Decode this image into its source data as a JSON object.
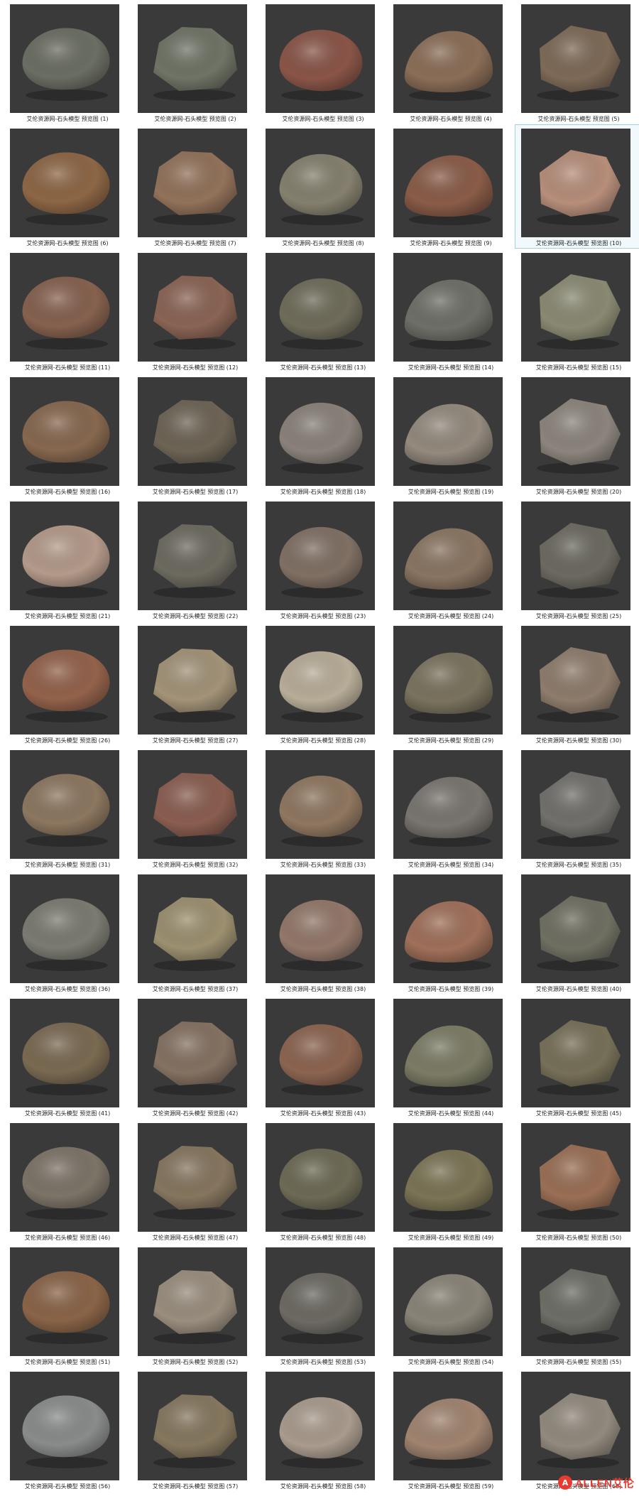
{
  "caption_prefix": "艾伦资源网-石头模型 预览图",
  "selected_index": 10,
  "watermark": {
    "icon": "logo-circle-icon",
    "text": "ALLEN艾伦"
  },
  "items": [
    {
      "label": "艾伦资源网-石头模型 预览图 (1)",
      "color": "#6b6e63"
    },
    {
      "label": "艾伦资源网-石头模型 预览图 (2)",
      "color": "#6f7466"
    },
    {
      "label": "艾伦资源网-石头模型 预览图 (3)",
      "color": "#8a5548"
    },
    {
      "label": "艾伦资源网-石头模型 预览图 (4)",
      "color": "#8b6e57"
    },
    {
      "label": "艾伦资源网-石头模型 预览图 (5)",
      "color": "#7e6a57"
    },
    {
      "label": "艾伦资源网-石头模型 预览图 (6)",
      "color": "#8d6645"
    },
    {
      "label": "艾伦资源网-石头模型 预览图 (7)",
      "color": "#92725a"
    },
    {
      "label": "艾伦资源网-石头模型 预览图 (8)",
      "color": "#85806e"
    },
    {
      "label": "艾伦资源网-石头模型 预览图 (9)",
      "color": "#8a5c48"
    },
    {
      "label": "艾伦资源网-石头模型 预览图 (10)",
      "color": "#b78e7a"
    },
    {
      "label": "艾伦资源网-石头模型 预览图 (11)",
      "color": "#86614f"
    },
    {
      "label": "艾伦资源网-石头模型 预览图 (12)",
      "color": "#8a6454"
    },
    {
      "label": "艾伦资源网-石头模型 预览图 (13)",
      "color": "#6f6c5a"
    },
    {
      "label": "艾伦资源网-石头模型 预览图 (14)",
      "color": "#6e7068"
    },
    {
      "label": "艾伦资源网-石头模型 预览图 (15)",
      "color": "#8a8a73"
    },
    {
      "label": "艾伦资源网-石头模型 预览图 (16)",
      "color": "#87684f"
    },
    {
      "label": "艾伦资源网-石头模型 预览图 (17)",
      "color": "#6d6455"
    },
    {
      "label": "艾伦资源网-石头模型 预览图 (18)",
      "color": "#8a827a"
    },
    {
      "label": "艾伦资源网-石头模型 预览图 (19)",
      "color": "#948a7e"
    },
    {
      "label": "艾伦资源网-石头模型 预览图 (20)",
      "color": "#8c857d"
    },
    {
      "label": "艾伦资源网-石头模型 预览图 (21)",
      "color": "#b49a8a"
    },
    {
      "label": "艾伦资源网-石头模型 预览图 (22)",
      "color": "#6d6a60"
    },
    {
      "label": "艾伦资源网-石头模型 预览图 (23)",
      "color": "#807064"
    },
    {
      "label": "艾伦资源网-石头模型 预览图 (24)",
      "color": "#8a7562"
    },
    {
      "label": "艾伦资源网-石头模型 预览图 (25)",
      "color": "#6c6a60"
    },
    {
      "label": "艾伦资源网-石头模型 预览图 (26)",
      "color": "#93624b"
    },
    {
      "label": "艾伦资源网-石头模型 预览图 (27)",
      "color": "#a39378"
    },
    {
      "label": "艾伦资源网-石头模型 预览图 (28)",
      "color": "#b8ad98"
    },
    {
      "label": "艾伦资源网-石头模型 预览图 (29)",
      "color": "#7a735e"
    },
    {
      "label": "艾伦资源网-石头模型 预览图 (30)",
      "color": "#8e7c6c"
    },
    {
      "label": "艾伦资源网-石头模型 预览图 (31)",
      "color": "#8c7760"
    },
    {
      "label": "艾伦资源网-石头模型 预览图 (32)",
      "color": "#8a5e50"
    },
    {
      "label": "艾伦资源网-石头模型 预览图 (33)",
      "color": "#8f7760"
    },
    {
      "label": "艾伦资源网-石头模型 预览图 (34)",
      "color": "#79756f"
    },
    {
      "label": "艾伦资源网-石头模型 预览图 (35)",
      "color": "#71706c"
    },
    {
      "label": "艾伦资源网-石头模型 预览图 (36)",
      "color": "#7c7b72"
    },
    {
      "label": "艾伦资源网-石头模型 预览图 (37)",
      "color": "#9c9070"
    },
    {
      "label": "艾伦资源网-石头模型 预览图 (38)",
      "color": "#93786a"
    },
    {
      "label": "艾伦资源网-石头模型 预览图 (39)",
      "color": "#a0705a"
    },
    {
      "label": "艾伦资源网-石头模型 预览图 (40)",
      "color": "#6f6f62"
    },
    {
      "label": "艾伦资源网-石头模型 预览图 (41)",
      "color": "#7a6a52"
    },
    {
      "label": "艾伦资源网-石头模型 预览图 (42)",
      "color": "#857262"
    },
    {
      "label": "艾伦资源网-石头模型 预览图 (43)",
      "color": "#8c6450"
    },
    {
      "label": "艾伦资源网-石头模型 预览图 (44)",
      "color": "#7c7c66"
    },
    {
      "label": "艾伦资源网-石头模型 预览图 (45)",
      "color": "#777058"
    },
    {
      "label": "艾伦资源网-石头模型 预览图 (46)",
      "color": "#7d7468"
    },
    {
      "label": "艾伦资源网-石头模型 预览图 (47)",
      "color": "#86765f"
    },
    {
      "label": "艾伦资源网-石头模型 预览图 (48)",
      "color": "#6d6a55"
    },
    {
      "label": "艾伦资源网-石头模型 预览图 (49)",
      "color": "#7b7455"
    },
    {
      "label": "艾伦资源网-石头模型 预览图 (50)",
      "color": "#9a6f55"
    },
    {
      "label": "艾伦资源网-石头模型 预览图 (51)",
      "color": "#8a6448"
    },
    {
      "label": "艾伦资源网-石头模型 预览图 (52)",
      "color": "#9a8e7e"
    },
    {
      "label": "艾伦资源网-石头模型 预览图 (53)",
      "color": "#6c6a62"
    },
    {
      "label": "艾伦资源网-石头模型 预览图 (54)",
      "color": "#8a8478"
    },
    {
      "label": "艾伦资源网-石头模型 预览图 (55)",
      "color": "#6d6e66"
    },
    {
      "label": "艾伦资源网-石头模型 预览图 (56)",
      "color": "#8a8c8c"
    },
    {
      "label": "艾伦资源网-石头模型 预览图 (57)",
      "color": "#86785f"
    },
    {
      "label": "艾伦资源网-石头模型 预览图 (58)",
      "color": "#a99b8d"
    },
    {
      "label": "艾伦资源网-石头模型 预览图 (59)",
      "color": "#a18470"
    },
    {
      "label": "艾伦资源网-石头模型 预览图 (60)",
      "color": "#928a7e"
    }
  ]
}
